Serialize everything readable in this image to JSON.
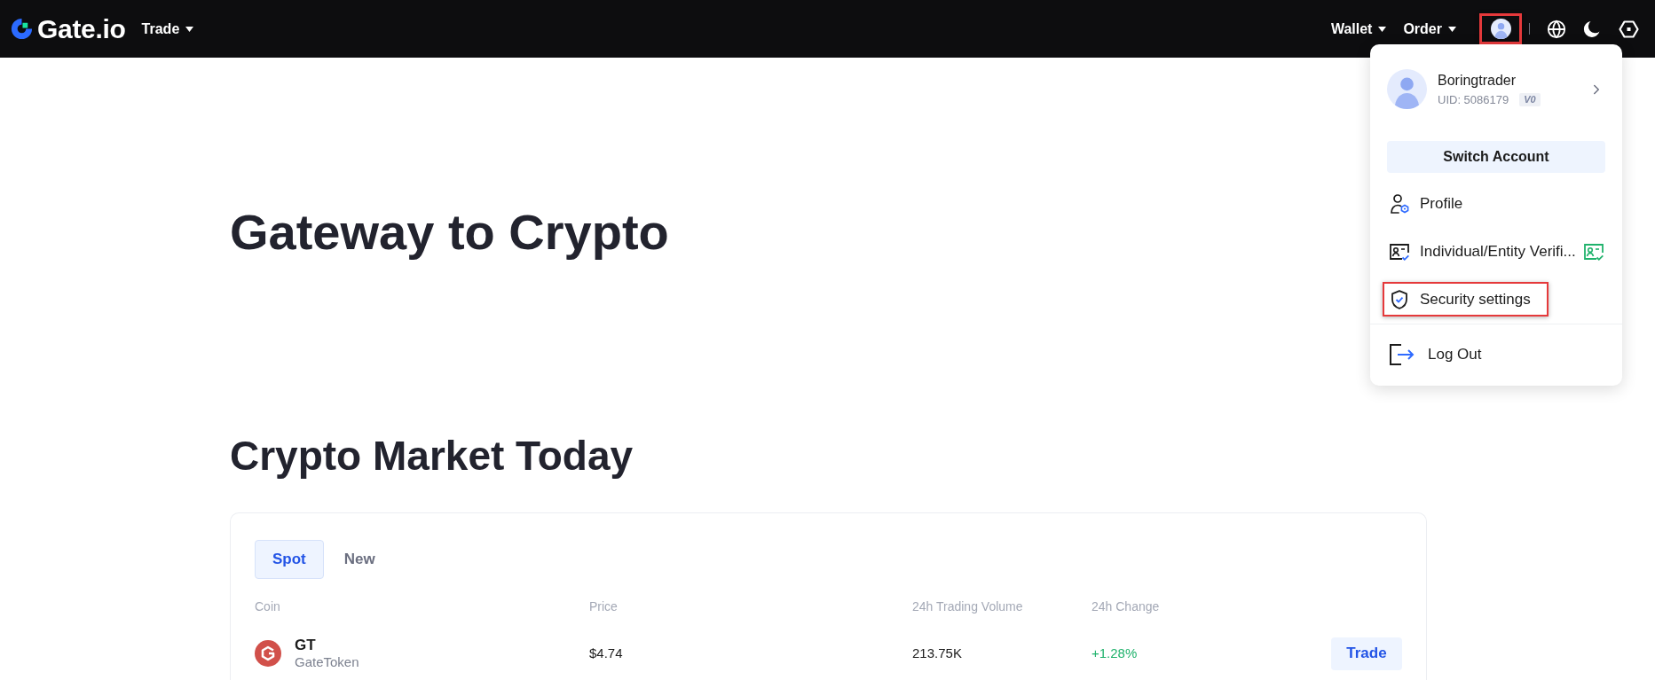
{
  "header": {
    "logo": "Gate.io",
    "nav": [
      {
        "label": "Trade",
        "dropdown": true
      }
    ],
    "right_nav": [
      {
        "label": "Wallet",
        "dropdown": true
      },
      {
        "label": "Order",
        "dropdown": true
      }
    ],
    "account_button": {
      "highlighted": true
    }
  },
  "account_menu": {
    "user": {
      "name": "Boringtrader",
      "uid": "UID: 5086179",
      "level": "V0"
    },
    "switch_button": "Switch Account",
    "items": [
      {
        "label": "Profile",
        "verified": false,
        "highlighted": false
      },
      {
        "label": "Individual/Entity Verifi...",
        "verified": true,
        "highlighted": false
      },
      {
        "label": "Security settings",
        "verified": false,
        "highlighted": true
      }
    ],
    "logout": {
      "label": "Log Out"
    }
  },
  "hero": {
    "title": "Gateway to Crypto"
  },
  "market": {
    "title": "Crypto Market Today",
    "tabs": [
      {
        "label": "Spot",
        "selected": true
      },
      {
        "label": "New",
        "selected": false
      }
    ],
    "columns": [
      "Coin",
      "Price",
      "24h Trading Volume",
      "24h Change"
    ],
    "rows": [
      {
        "symbol": "GT",
        "name": "GateToken",
        "price": "$4.74",
        "volume": "213.75K",
        "change": "+1.28%",
        "positive": true,
        "action": "Trade"
      }
    ]
  }
}
